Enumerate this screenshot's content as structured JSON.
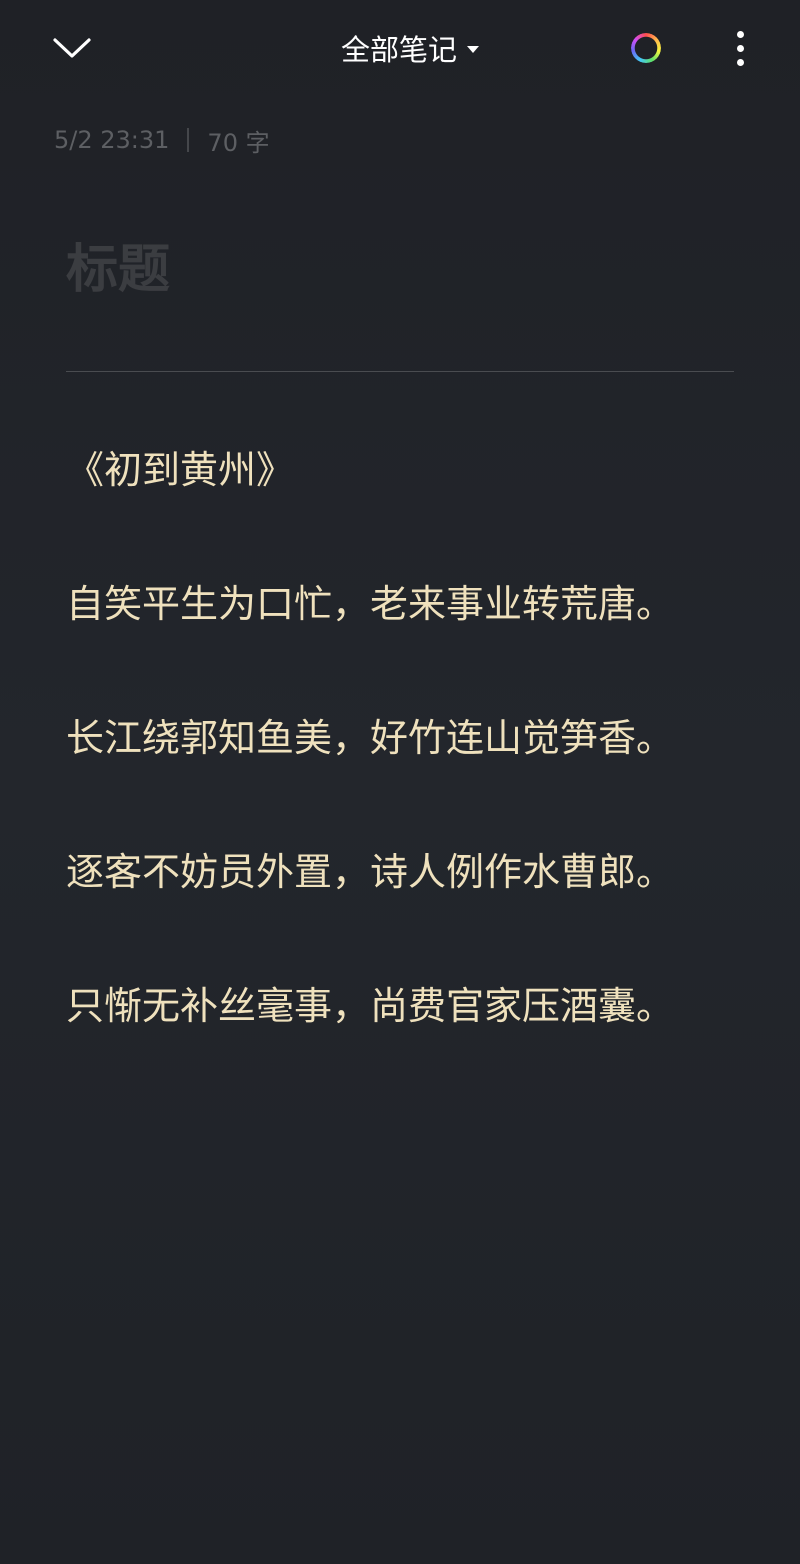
{
  "header": {
    "title": "全部笔记",
    "back_icon": "chevron-down-icon",
    "color_icon": "color-ring-icon",
    "more_icon": "more-vertical-icon"
  },
  "note": {
    "timestamp": "5/2 23:31",
    "word_count": "70 字",
    "title_placeholder": "标题",
    "lines": [
      "《初到黄州》",
      "自笑平生为口忙，老来事业转荒唐。",
      "长江绕郭知鱼美，好竹连山觉笋香。",
      "逐客不妨员外置，诗人例作水曹郎。",
      "只惭无补丝毫事，尚费官家压酒囊。"
    ]
  },
  "colors": {
    "background": "#212429",
    "text": "#efe1bd",
    "meta": "#5d5f63",
    "placeholder": "#3b3d41"
  }
}
